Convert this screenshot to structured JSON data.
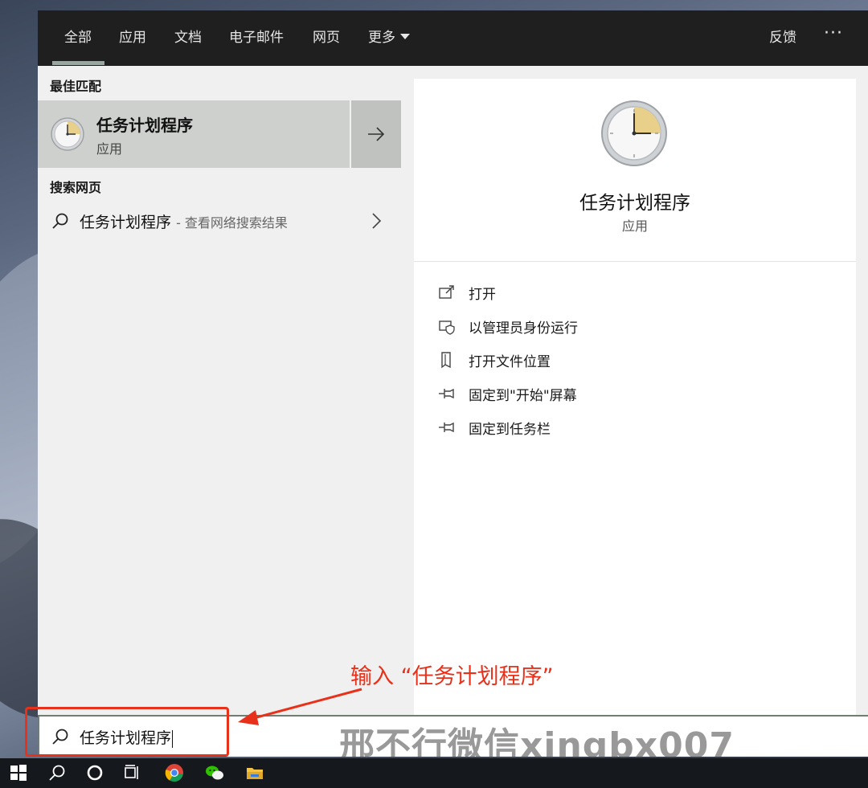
{
  "tabs": [
    {
      "label": "全部",
      "active": true
    },
    {
      "label": "应用"
    },
    {
      "label": "文档"
    },
    {
      "label": "电子邮件"
    },
    {
      "label": "网页"
    },
    {
      "label": "更多"
    }
  ],
  "feedback_label": "反馈",
  "more_options_label": "···",
  "best_match": {
    "header": "最佳匹配",
    "title": "任务计划程序",
    "subtitle": "应用"
  },
  "web_search": {
    "header": "搜索网页",
    "query": "任务计划程序",
    "description": "- 查看网络搜索结果"
  },
  "preview": {
    "title": "任务计划程序",
    "subtitle": "应用",
    "actions": [
      {
        "label": "打开",
        "icon": "open-window-icon"
      },
      {
        "label": "以管理员身份运行",
        "icon": "shield-admin-icon"
      },
      {
        "label": "打开文件位置",
        "icon": "file-location-icon"
      },
      {
        "label": "固定到\"开始\"屏幕",
        "icon": "pin-icon"
      },
      {
        "label": "固定到任务栏",
        "icon": "pin-icon"
      }
    ]
  },
  "search_box": {
    "value": "任务计划程序"
  },
  "annotation": {
    "text": "输入 “任务计划程序”",
    "color": "#e8311a"
  },
  "watermark": "邢不行微信xingbx007",
  "taskbar": [
    {
      "name": "windows-start-icon"
    },
    {
      "name": "search-icon"
    },
    {
      "name": "cortana-icon"
    },
    {
      "name": "task-view-icon"
    },
    {
      "name": "chrome-icon"
    },
    {
      "name": "wechat-icon"
    },
    {
      "name": "file-explorer-icon"
    }
  ],
  "colors": {
    "topbar": "#1f1f1f",
    "selection": "#cdd0cc",
    "annotation": "#e8311a"
  }
}
